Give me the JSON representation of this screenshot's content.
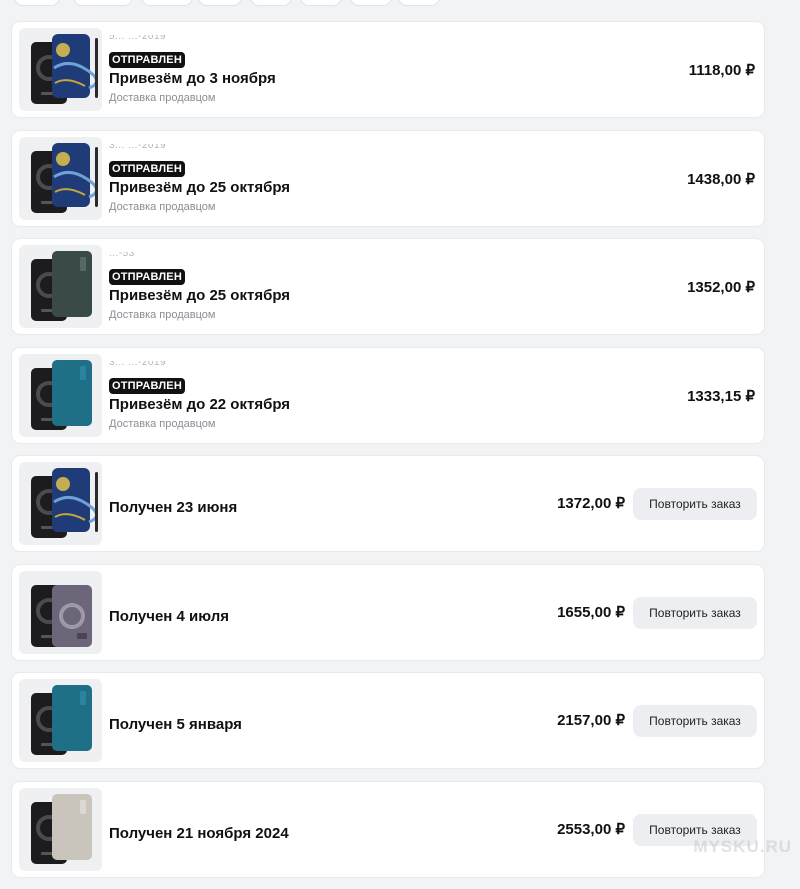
{
  "currency": "₽",
  "orders": [
    {
      "number": "5... ...-2019",
      "badge": "ОТПРАВЛЕН",
      "title": "Привезём до 3 ноября",
      "subtitle": "Доставка продавцом",
      "price": "1118,00 ₽",
      "product": "starry",
      "button": null
    },
    {
      "number": "3... ...-2019",
      "badge": "ОТПРАВЛЕН",
      "title": "Привезём до 25 октября",
      "subtitle": "Доставка продавцом",
      "price": "1438,00 ₽",
      "product": "starry",
      "button": null
    },
    {
      "number": "...-53",
      "badge": "ОТПРАВЛЕН",
      "title": "Привезём до 25 октября",
      "subtitle": "Доставка продавцом",
      "price": "1352,00 ₽",
      "product": "dark-green",
      "button": null
    },
    {
      "number": "3... ...-2019",
      "badge": "ОТПРАВЛЕН",
      "title": "Привезём до 22 октября",
      "subtitle": "Доставка продавцом",
      "price": "1333,15 ₽",
      "product": "teal",
      "button": null
    },
    {
      "number": "",
      "badge": "",
      "title": "Получен 23 июня",
      "subtitle": "",
      "price": "1372,00 ₽",
      "product": "starry",
      "button": "Повторить заказ"
    },
    {
      "number": "",
      "badge": "",
      "title": "Получен 4 июля",
      "subtitle": "",
      "price": "1655,00 ₽",
      "product": "purple",
      "button": "Повторить заказ"
    },
    {
      "number": "",
      "badge": "",
      "title": "Получен 5 января",
      "subtitle": "",
      "price": "2157,00 ₽",
      "product": "teal",
      "button": "Повторить заказ"
    },
    {
      "number": "",
      "badge": "",
      "title": "Получен 21 ноября 2024",
      "subtitle": "",
      "price": "2553,00 ₽",
      "product": "beige",
      "button": "Повторить заказ"
    }
  ],
  "colors": {
    "badge_bg": "#111111",
    "button_bg": "#eceef2",
    "page_bg": "#f2f3f5"
  },
  "watermark": "MYSKU.RU"
}
